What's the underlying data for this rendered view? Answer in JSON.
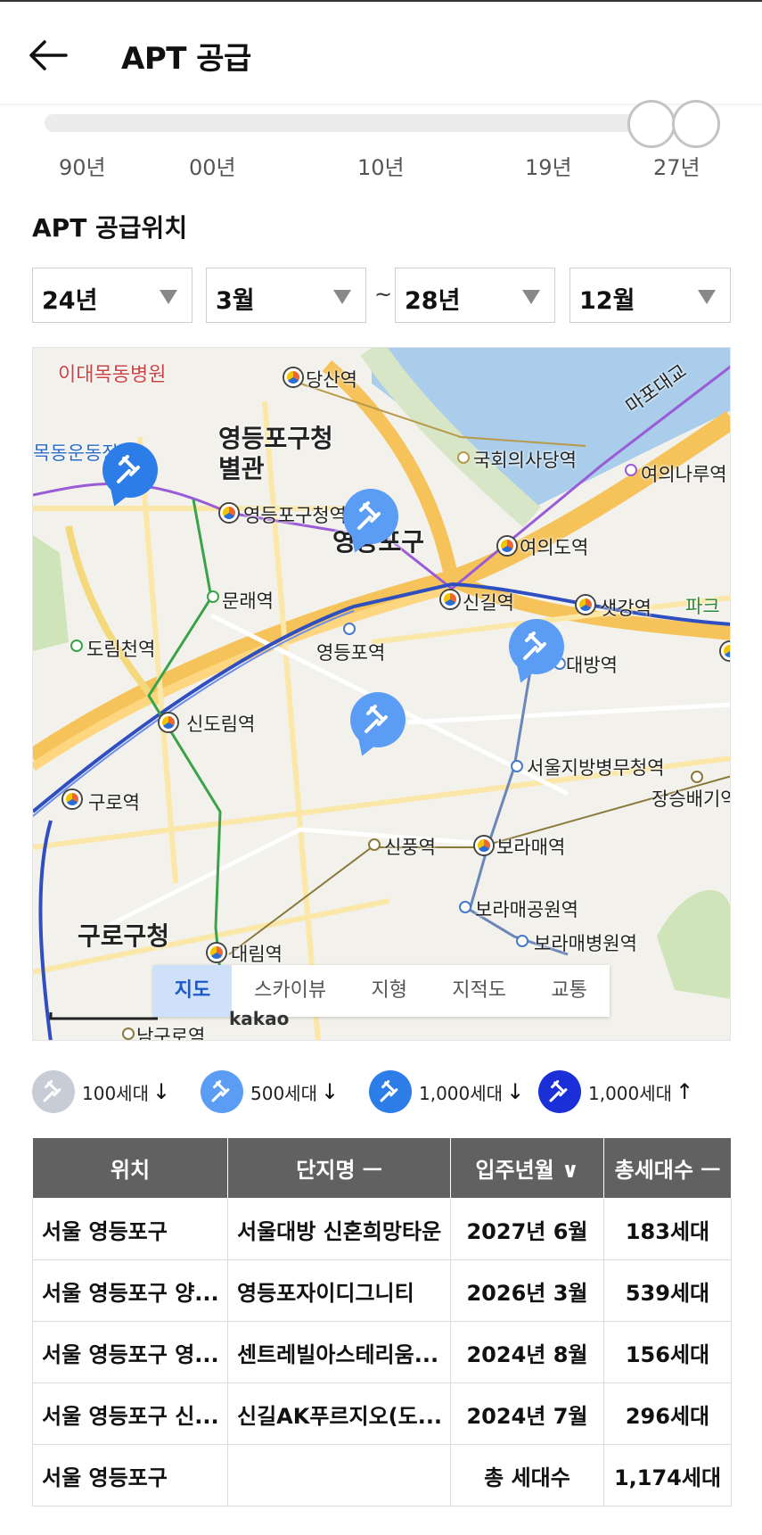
{
  "header": {
    "title": "APT 공급"
  },
  "slider": {
    "ticks": [
      "90년",
      "00년",
      "10년",
      "19년",
      "27년"
    ]
  },
  "section": {
    "title": "APT 공급위치"
  },
  "filters": {
    "start_year": "24년",
    "start_month": "3월",
    "separator": "~",
    "end_year": "28년",
    "end_month": "12월"
  },
  "map": {
    "labels": {
      "l1": "이대목동병원",
      "l2": "당산역",
      "l3": "마포대교",
      "l4": "영등포구청",
      "l5": "별관",
      "l6": "국회의사당역",
      "l7": "여의나루역",
      "l8": "목동운동장",
      "l9": "영등포구청역",
      "l10": "영등포구",
      "l11": "여의도역",
      "l12": "문래역",
      "l13": "신길역",
      "l14": "샛강역",
      "l15": "파크",
      "l16": "도림천역",
      "l17": "영등포역",
      "l18": "대방역",
      "l19": "신도림역",
      "l20": "서울지방병무청역",
      "l21": "구로역",
      "l22": "장승배기역",
      "l23": "신풍역",
      "l24": "보라매역",
      "l25": "구로구청",
      "l26": "보라매공원역",
      "l27": "보라매병원역",
      "l28": "대림역",
      "l29": "남구로역",
      "l30": "kakao"
    },
    "tabs": [
      "지도",
      "스카이뷰",
      "지형",
      "지적도",
      "교통"
    ]
  },
  "legend": [
    {
      "label": "100세대",
      "arrow": "↓",
      "color": "#c8ccd6"
    },
    {
      "label": "500세대",
      "arrow": "↓",
      "color": "#5b9cf5"
    },
    {
      "label": "1,000세대",
      "arrow": "↓",
      "color": "#2d7de8"
    },
    {
      "label": "1,000세대",
      "arrow": "↑",
      "color": "#1a2fd8"
    }
  ],
  "table": {
    "headers": [
      "위치",
      "단지명 ㅡ",
      "입주년월 ∨",
      "총세대수 ㅡ"
    ],
    "rows": [
      [
        "서울 영등포구",
        "서울대방 신혼희망타운",
        "2027년 6월",
        "183세대"
      ],
      [
        "서울 영등포구 양...",
        "영등포자이디그니티",
        "2026년 3월",
        "539세대"
      ],
      [
        "서울 영등포구 영...",
        "센트레빌아스테리움...",
        "2024년 8월",
        "156세대"
      ],
      [
        "서울 영등포구 신...",
        "신길AK푸르지오(도...",
        "2024년 7월",
        "296세대"
      ]
    ],
    "total": {
      "location": "서울 영등포구",
      "label": "총 세대수",
      "value": "1,174세대"
    }
  }
}
